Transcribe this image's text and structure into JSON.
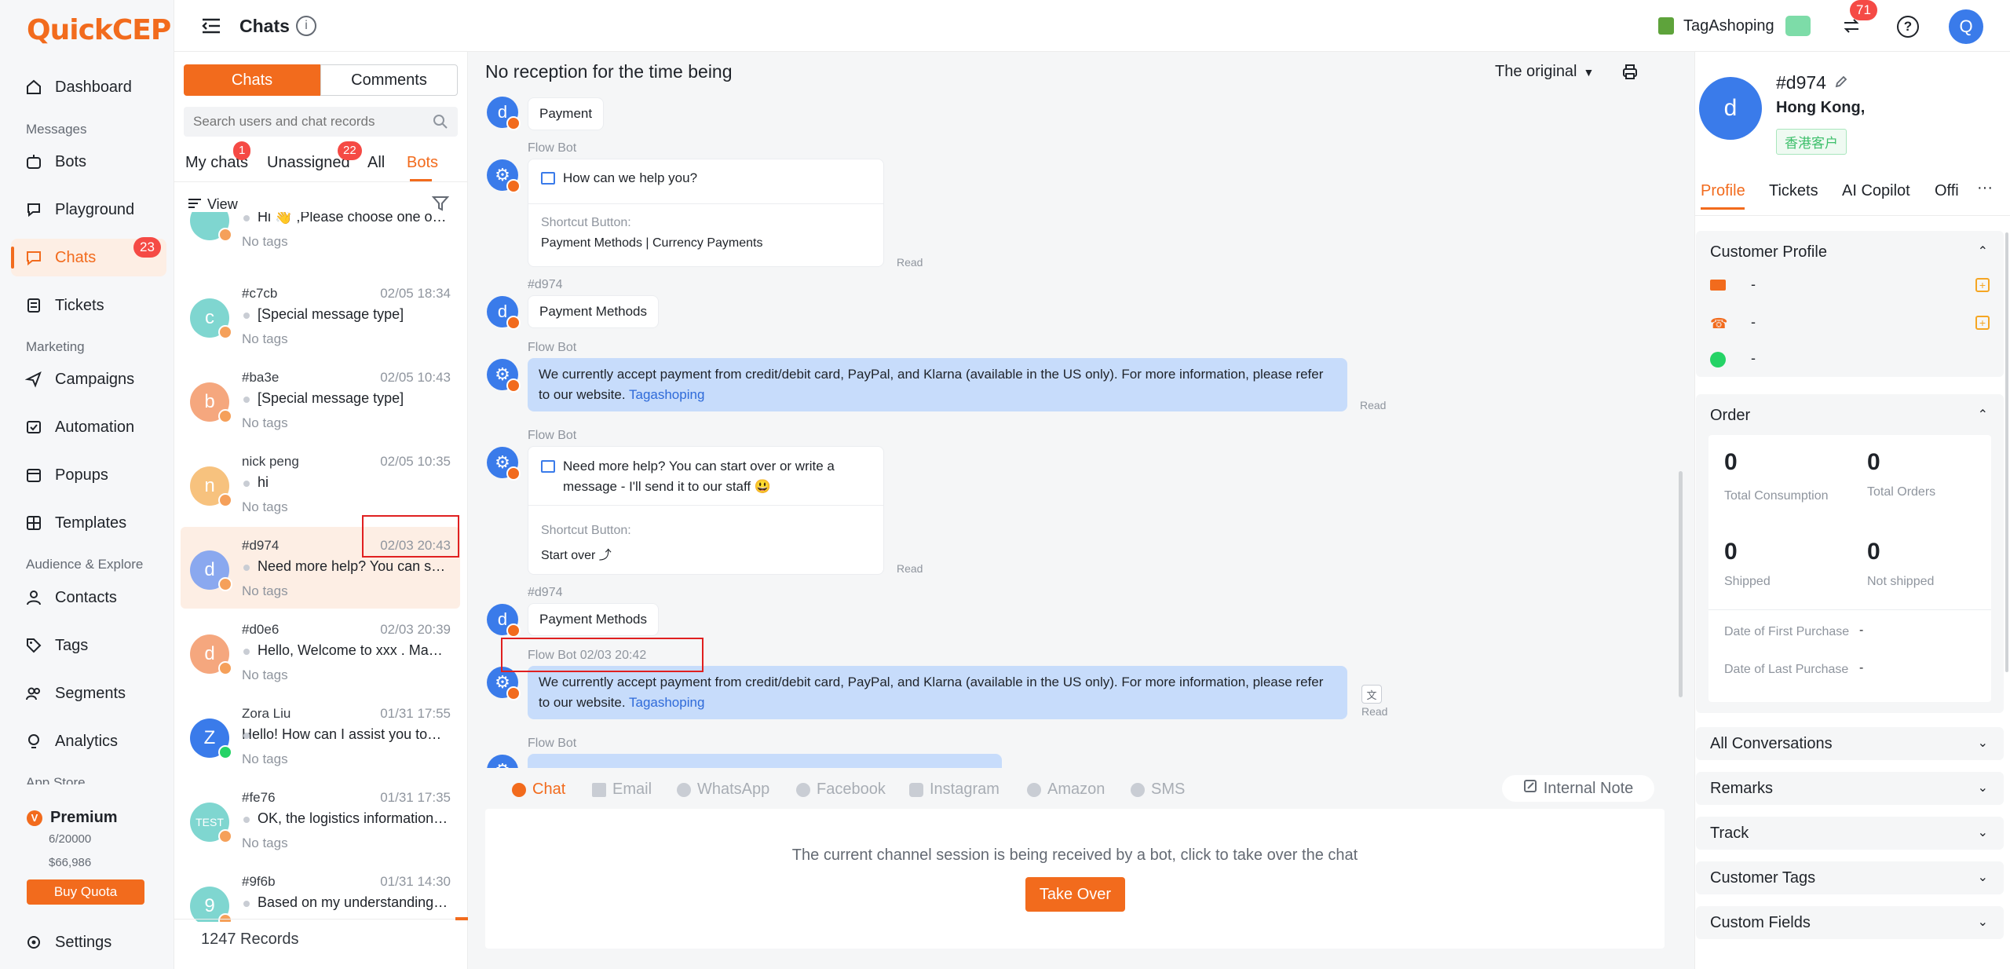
{
  "brand": {
    "logo": "QuickCEP",
    "accent": "#f26b1d"
  },
  "nav": {
    "dashboard": "Dashboard",
    "sec_messages": "Messages",
    "bots": "Bots",
    "playground": "Playground",
    "chats": "Chats",
    "chats_badge": "23",
    "tickets": "Tickets",
    "sec_marketing": "Marketing",
    "campaigns": "Campaigns",
    "automation": "Automation",
    "popups": "Popups",
    "templates": "Templates",
    "sec_audience": "Audience & Explore",
    "contacts": "Contacts",
    "tags": "Tags",
    "segments": "Segments",
    "analytics": "Analytics",
    "sec_app": "App Store",
    "plan": "Premium",
    "usage": "6/20000",
    "amount": "$66,986",
    "buy": "Buy Quota",
    "settings": "Settings"
  },
  "header": {
    "title": "Chats",
    "store": "TagAshoping",
    "switch_badge": "71",
    "avatar": "Q"
  },
  "list": {
    "seg_chats": "Chats",
    "seg_comments": "Comments",
    "search_placeholder": "Search users and chat records",
    "tab_mine": "My chats",
    "tab_mine_badge": "1",
    "tab_unassigned": "Unassigned",
    "tab_unassigned_badge": "22",
    "tab_all": "All",
    "tab_bots": "Bots",
    "view": "View",
    "records": "1247 Records",
    "items": [
      {
        "name": "",
        "time": "",
        "msg": "Hi 👋 ,Please choose one of th...",
        "tags": "No tags",
        "initial": "",
        "color": "#7fd6d0"
      },
      {
        "name": "#c7cb",
        "time": "02/05 18:34",
        "msg": "[Special message type]",
        "tags": "No tags",
        "initial": "c",
        "color": "#7fd6d0"
      },
      {
        "name": "#ba3e",
        "time": "02/05 10:43",
        "msg": "[Special message type]",
        "tags": "No tags",
        "initial": "b",
        "color": "#f5a77e"
      },
      {
        "name": "nick peng",
        "time": "02/05 10:35",
        "msg": "hi",
        "tags": "No tags",
        "initial": "n",
        "color": "#f7c27e"
      },
      {
        "name": "#d974",
        "time": "02/03 20:43",
        "msg": "Need more help? You can start ...",
        "tags": "No tags",
        "initial": "d",
        "color": "#8aa8ef"
      },
      {
        "name": "#d0e6",
        "time": "02/03 20:39",
        "msg": "Hello, Welcome to xxx . May i ...",
        "tags": "No tags",
        "initial": "d",
        "color": "#f5a77e"
      },
      {
        "name": "Zora Liu",
        "time": "01/31 17:55",
        "msg": "Hello! How can I assist you today?",
        "tags": "No tags",
        "initial": "Z",
        "color": "#3a7bea"
      },
      {
        "name": "#fe76",
        "time": "01/31 17:35",
        "msg": "OK, the logistics information fo...",
        "tags": "No tags",
        "initial": "TEST",
        "color": "#7fd6d0"
      },
      {
        "name": "#9f6b",
        "time": "01/31 14:30",
        "msg": "Based on my understanding, I ...",
        "tags": "",
        "initial": "9",
        "color": "#7fd6d0"
      }
    ]
  },
  "conv": {
    "title": "No reception for the time being",
    "original": "The original",
    "payment": "Payment",
    "flowbot": "Flow Bot",
    "help_q": "How can we help you?",
    "shortcut_label": "Shortcut Button:",
    "shortcut_1": "Payment Methods | Currency Payments",
    "user_id": "#d974",
    "payment_methods": "Payment Methods",
    "accept_text": "We currently accept payment from credit/debit card, PayPal, and Klarna (available in the US only). For more information, please refer to our website.",
    "site_link": "Tagashoping",
    "more_help": "Need more help? You can start over or write a message - I'll send it to our staff 😃",
    "shortcut_2": "Start over ⤴",
    "read": "Read",
    "user_id_2": "#d974",
    "payment_methods_2": "Payment Methods",
    "flowbot_time": "Flow Bot  02/03 20:42",
    "flowbot_last": "Flow Bot",
    "channels": [
      "Chat",
      "Email",
      "WhatsApp",
      "Facebook",
      "Instagram",
      "Amazon",
      "SMS"
    ],
    "internal_note": "Internal Note",
    "notice": "The current channel session is being received by a bot, click to take over the chat",
    "takeover": "Take Over"
  },
  "profile": {
    "initial": "d",
    "id": "#d974",
    "location": "Hong Kong,",
    "tag": "香港客户",
    "tabs": [
      "Profile",
      "Tickets",
      "AI Copilot",
      "Offi"
    ],
    "customer_profile": "Customer Profile",
    "email": "-",
    "phone": "-",
    "whatsapp": "-",
    "order": "Order",
    "consumption_val": "0",
    "consumption_lbl": "Total Consumption",
    "orders_val": "0",
    "orders_lbl": "Total Orders",
    "shipped_val": "0",
    "shipped_lbl": "Shipped",
    "notshipped_val": "0",
    "notshipped_lbl": "Not shipped",
    "first_purchase_lbl": "Date of First Purchase",
    "first_purchase": "-",
    "last_purchase_lbl": "Date of Last Purchase",
    "last_purchase": "-",
    "sections": [
      "All Conversations",
      "Remarks",
      "Track",
      "Customer Tags",
      "Custom Fields"
    ]
  }
}
